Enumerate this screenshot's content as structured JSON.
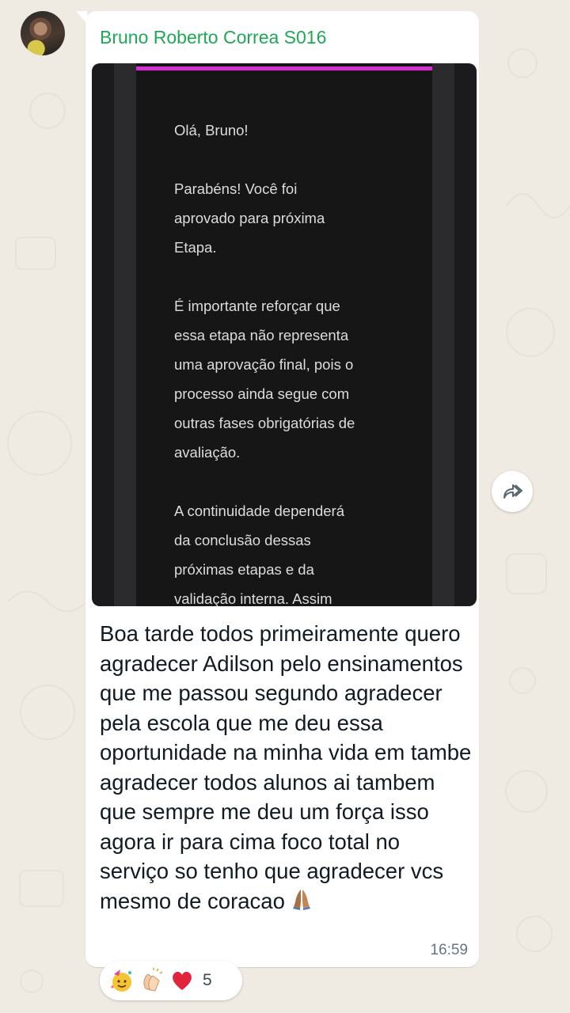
{
  "message": {
    "sender_name": "Bruno Roberto Correa S016",
    "image_text": "Olá, Bruno!\n\nParabéns! Você foi\naprovado para próxima\nEtapa.\n\nÉ importante reforçar que\nessa etapa não representa\numa aprovação final, pois o\nprocesso ainda segue com\noutras fases obrigatórias de\navaliação.\n\nA continuidade dependerá\nda conclusão dessas\npróximas etapas e da\nvalidação interna. Assim",
    "body_text": "Boa tarde todos primeiramente quero agradecer Adilson pelo ensinamentos que me passou segundo agradecer pela escola que me deu essa oportunidade na minha vida em tambe agradecer todos alunos ai tambem que sempre me deu um força isso agora ir para cima foco total no serviço so tenho que agradecer vcs mesmo de coracao",
    "time": "16:59"
  },
  "reactions": {
    "icons": [
      "party-face-icon",
      "clapping-hands-icon",
      "red-heart-icon"
    ],
    "count": "5"
  },
  "colors": {
    "sender": "#1fa855",
    "image_accent_bar": "#d62fd6",
    "background": "#efeae2"
  }
}
